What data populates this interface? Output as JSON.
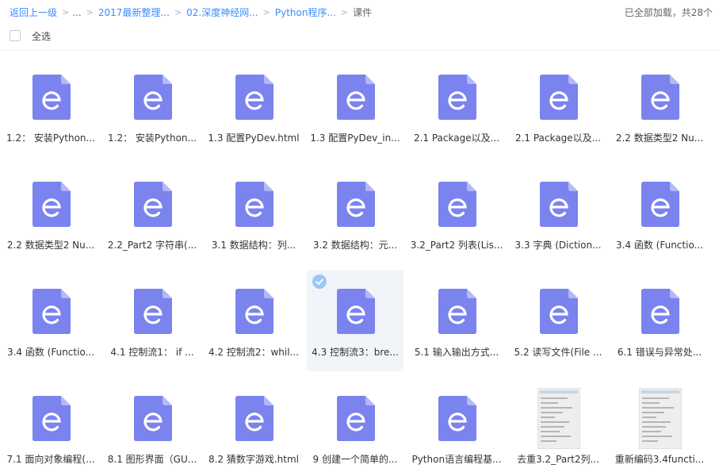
{
  "breadcrumb": {
    "back": "返回上一级",
    "ellipsis": "...",
    "items": [
      "2017最新整理...",
      "02.深度神经网...",
      "Python程序..."
    ],
    "current": "课件",
    "separator": ">"
  },
  "status": {
    "loaded_text": "已全部加载，共28个"
  },
  "select_all": {
    "label": "全选"
  },
  "colors": {
    "accent": "#3b8cff",
    "file_icon": "#7b83ef",
    "file_icon_fold": "#b3b8f7",
    "selected_bg": "#f1f5fa"
  },
  "files": [
    {
      "name": "1.2： 安装Python...",
      "type": "html",
      "icon": "e-file-icon"
    },
    {
      "name": "1.2： 安装Python...",
      "type": "html",
      "icon": "e-file-icon"
    },
    {
      "name": "1.3 配置PyDev.html",
      "type": "html",
      "icon": "e-file-icon"
    },
    {
      "name": "1.3 配置PyDev_in...",
      "type": "html",
      "icon": "e-file-icon"
    },
    {
      "name": "2.1 Package以及...",
      "type": "html",
      "icon": "e-file-icon"
    },
    {
      "name": "2.1 Package以及...",
      "type": "html",
      "icon": "e-file-icon"
    },
    {
      "name": "2.2 数据类型2 Nu...",
      "type": "html",
      "icon": "e-file-icon"
    },
    {
      "name": "2.2 数据类型2 Nu...",
      "type": "html",
      "icon": "e-file-icon"
    },
    {
      "name": "2.2_Part2 字符串(...",
      "type": "html",
      "icon": "e-file-icon"
    },
    {
      "name": "3.1 数据结构：列...",
      "type": "html",
      "icon": "e-file-icon"
    },
    {
      "name": "3.2 数据结构：元...",
      "type": "html",
      "icon": "e-file-icon"
    },
    {
      "name": "3.2_Part2 列表(Lis...",
      "type": "html",
      "icon": "e-file-icon"
    },
    {
      "name": "3.3 字典 (Diction...",
      "type": "html",
      "icon": "e-file-icon"
    },
    {
      "name": "3.4 函数 (Functio...",
      "type": "html",
      "icon": "e-file-icon"
    },
    {
      "name": "3.4 函数 (Functio...",
      "type": "html",
      "icon": "e-file-icon"
    },
    {
      "name": "4.1 控制流1： if ...",
      "type": "html",
      "icon": "e-file-icon"
    },
    {
      "name": "4.2 控制流2：whil...",
      "type": "html",
      "icon": "e-file-icon"
    },
    {
      "name": "4.3 控制流3：bre...",
      "type": "html",
      "icon": "e-file-icon",
      "selected": true
    },
    {
      "name": "5.1 输入输出方式...",
      "type": "html",
      "icon": "e-file-icon"
    },
    {
      "name": "5.2 读写文件(File ...",
      "type": "html",
      "icon": "e-file-icon"
    },
    {
      "name": "6.1 错误与异常处...",
      "type": "html",
      "icon": "e-file-icon"
    },
    {
      "name": "7.1 面向对象编程(...",
      "type": "html",
      "icon": "e-file-icon"
    },
    {
      "name": "8.1 图形界面（GU...",
      "type": "html",
      "icon": "e-file-icon"
    },
    {
      "name": "8.2 猜数字游戏.html",
      "type": "html",
      "icon": "e-file-icon"
    },
    {
      "name": "9 创建一个简单的...",
      "type": "html",
      "icon": "e-file-icon"
    },
    {
      "name": "Python语言编程基...",
      "type": "html",
      "icon": "e-file-icon"
    },
    {
      "name": "去重3.2_Part2列...",
      "type": "image",
      "icon": "image-thumbnail"
    },
    {
      "name": "重新编码3.4functi...",
      "type": "image",
      "icon": "image-thumbnail"
    }
  ]
}
